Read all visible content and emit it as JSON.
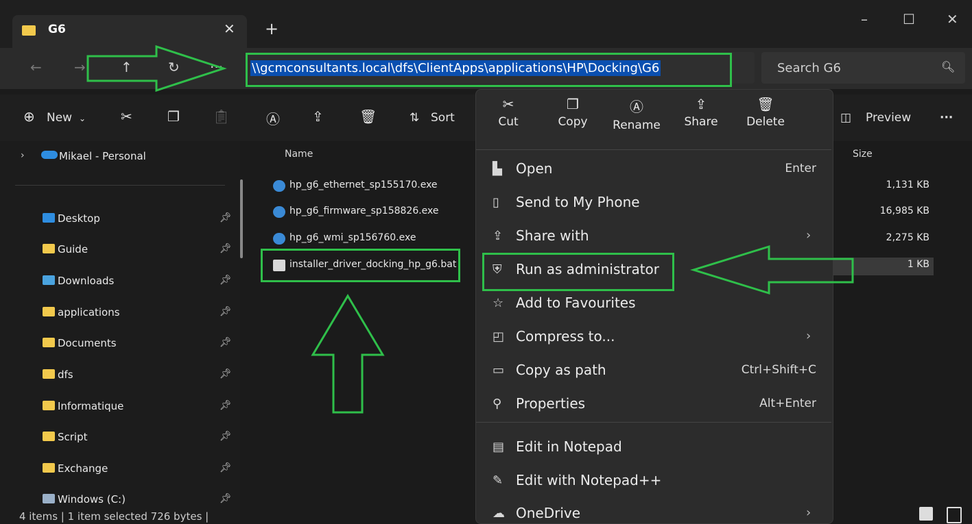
{
  "window": {
    "tab_title": "G6",
    "tab_close": "✕",
    "new_tab": "+",
    "min": "–",
    "max": "☐",
    "close": "✕"
  },
  "address": {
    "path": "\\\\gcmconsultants.local\\dfs\\ClientApps\\applications\\HP\\Docking\\G6",
    "search_placeholder": "Search G6"
  },
  "toolbar": {
    "new_label": "New",
    "sort_label": "Sort",
    "preview_label": "Preview",
    "more_label": "···"
  },
  "sidebar": {
    "onedrive_label": "Mikael - Personal",
    "items": [
      {
        "label": "Desktop",
        "color": "#2e8de0"
      },
      {
        "label": "Guide",
        "color": "#f2c94c"
      },
      {
        "label": "Downloads",
        "color": "#4aa3df"
      },
      {
        "label": "applications",
        "color": "#f2c94c"
      },
      {
        "label": "Documents",
        "color": "#f2c94c"
      },
      {
        "label": "dfs",
        "color": "#f2c94c"
      },
      {
        "label": "Informatique",
        "color": "#f2c94c"
      },
      {
        "label": "Script",
        "color": "#f2c94c"
      },
      {
        "label": "Exchange",
        "color": "#f2c94c"
      },
      {
        "label": "Windows (C:)",
        "color": "#9ab0c8"
      }
    ]
  },
  "files": {
    "col_name": "Name",
    "col_size": "Size",
    "rows": [
      {
        "name": "hp_g6_ethernet_sp155170.exe",
        "size": "1,131 KB"
      },
      {
        "name": "hp_g6_firmware_sp158826.exe",
        "size": "16,985 KB"
      },
      {
        "name": "hp_g6_wmi_sp156760.exe",
        "size": "2,275 KB"
      },
      {
        "name": "installer_driver_docking_hp_g6.bat",
        "size": "1 KB"
      }
    ]
  },
  "context_menu": {
    "quick_actions": [
      "Cut",
      "Copy",
      "Rename",
      "Share",
      "Delete"
    ],
    "items": [
      {
        "label": "Open",
        "shortcut": "Enter"
      },
      {
        "label": "Send to My Phone",
        "shortcut": ""
      },
      {
        "label": "Share with",
        "shortcut": ""
      },
      {
        "label": "Run as administrator",
        "shortcut": ""
      },
      {
        "label": "Add to Favourites",
        "shortcut": ""
      },
      {
        "label": "Compress to...",
        "shortcut": ""
      },
      {
        "label": "Copy as path",
        "shortcut": "Ctrl+Shift+C"
      },
      {
        "label": "Properties",
        "shortcut": "Alt+Enter"
      },
      {
        "label": "Edit in Notepad",
        "shortcut": ""
      },
      {
        "label": "Edit with Notepad++",
        "shortcut": ""
      },
      {
        "label": "OneDrive",
        "shortcut": ""
      }
    ]
  },
  "status": {
    "text": "4 items  |  1 item selected  726 bytes  |"
  },
  "colors": {
    "annotation_green": "#2fbf4a",
    "selection_blue": "#0a4fb0"
  }
}
